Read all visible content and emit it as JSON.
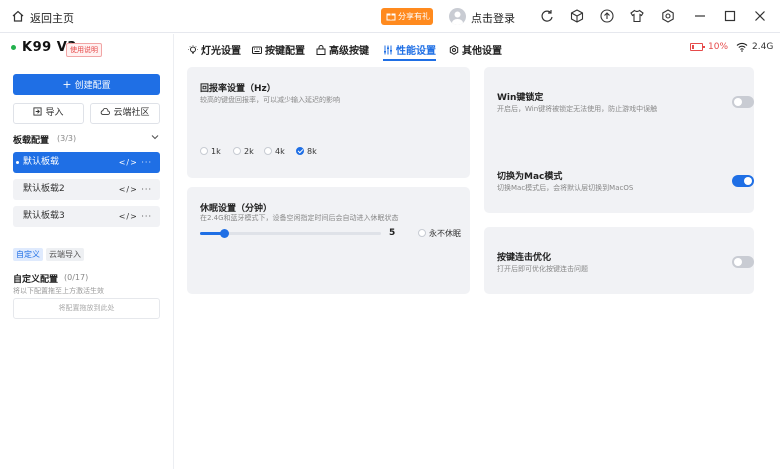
{
  "titlebar": {
    "back_label": "返回主页",
    "share_label": "分享有礼",
    "login_label": "点击登录",
    "icons": [
      "refresh-icon",
      "cube-icon",
      "upload-icon",
      "shirt-icon",
      "settings-icon"
    ],
    "window": [
      "minimize-icon",
      "maximize-icon",
      "close-icon"
    ]
  },
  "sidebar": {
    "device_name": "K99 V3",
    "device_badge": "使用说明",
    "create_label": "创建配置",
    "import_label": "导入",
    "cloud_label": "云端社区",
    "profiles_header": "板载配置",
    "profiles_count": "(3/3)",
    "profiles": [
      {
        "label": "默认板载",
        "active": true
      },
      {
        "label": "默认板载2",
        "active": false
      },
      {
        "label": "默认板载3",
        "active": false
      }
    ],
    "profile_icons": "</> ···",
    "tag_custom": "自定义",
    "tag_cloud_import": "云端导入",
    "custom_header": "自定义配置",
    "custom_count": "(0/17)",
    "custom_hint": "将以下配置拖至上方激活生效",
    "drop_zone": "将配置拖放到此处"
  },
  "tabs": [
    {
      "label": "灯光设置",
      "icon": "bulb-icon"
    },
    {
      "label": "按键配置",
      "icon": "keyboard-icon"
    },
    {
      "label": "高级按键",
      "icon": "lock-key-icon"
    },
    {
      "label": "性能设置",
      "icon": "sliders-icon",
      "active": true
    },
    {
      "label": "其他设置",
      "icon": "gear-icon"
    }
  ],
  "status": {
    "battery": "10%",
    "connection": "2.4G",
    "battery_color": "#e64a4a"
  },
  "polling": {
    "title": "回报率设置（Hz）",
    "desc": "较高的键盘回报率，可以减少输入延迟的影响",
    "options": [
      "1k",
      "2k",
      "4k",
      "8k"
    ],
    "selected": "8k"
  },
  "sleep": {
    "title": "休眠设置（分钟）",
    "desc": "在2.4G和蓝牙模式下，设备空闲指定时间后会自动进入休眠状态",
    "value": "5",
    "fraction": 0.13,
    "never_label": "永不休眠"
  },
  "win_lock": {
    "title": "Win键锁定",
    "desc": "开启后，Win键将被锁定无法使用，防止游戏中误触",
    "on": false
  },
  "mac_mode": {
    "title": "切换为Mac模式",
    "desc": "切换Mac模式后，会将默认层切换到MacOS",
    "on": true
  },
  "key_repeat": {
    "title": "按键连击优化",
    "desc": "打开后即可优化按键连击问题",
    "on": false
  },
  "colors": {
    "accent": "#1f6fe5",
    "share": "#ff8a1e"
  }
}
